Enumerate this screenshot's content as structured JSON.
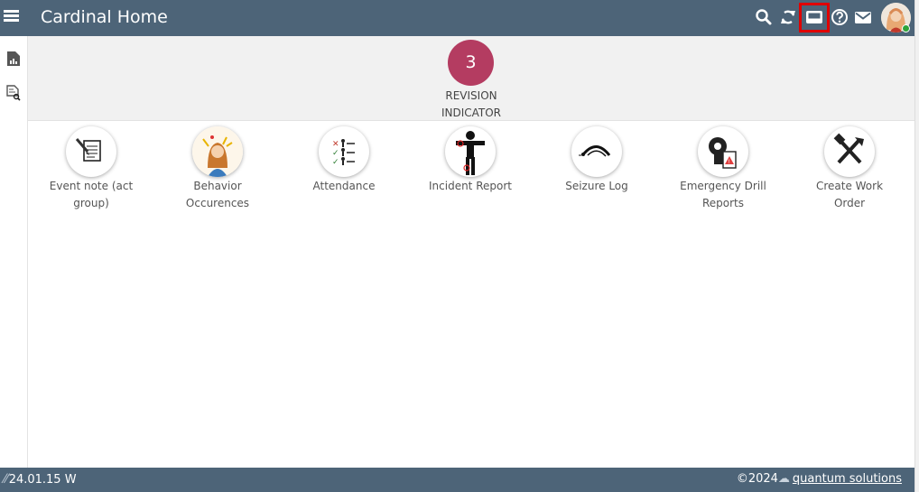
{
  "header": {
    "title": "Cardinal Home",
    "icons": [
      "menu-icon",
      "search-icon",
      "sync-icon",
      "window-icon",
      "help-icon",
      "mail-icon",
      "avatar"
    ]
  },
  "revision": {
    "count": "3",
    "label_line1": "REVISION",
    "label_line2": "INDICATOR"
  },
  "tiles": [
    {
      "label": "Event note (act\ngroup)",
      "icon": "notepad-icon"
    },
    {
      "label": "Behavior\nOccurences",
      "icon": "behavior-icon"
    },
    {
      "label": "Attendance",
      "icon": "attendance-icon"
    },
    {
      "label": "Incident Report",
      "icon": "incident-icon"
    },
    {
      "label": "Seizure Log",
      "icon": "seizure-icon"
    },
    {
      "label": "Emergency Drill\nReports",
      "icon": "emergency-drill-icon"
    },
    {
      "label": "Create Work\nOrder",
      "icon": "tools-icon"
    }
  ],
  "footer": {
    "version": "24.01.15 W",
    "copyright": "©2024",
    "company": "quantum solutions"
  },
  "colors": {
    "header_bg": "#4d6478",
    "revision_badge": "#b43c61",
    "highlight": "#e00000"
  }
}
